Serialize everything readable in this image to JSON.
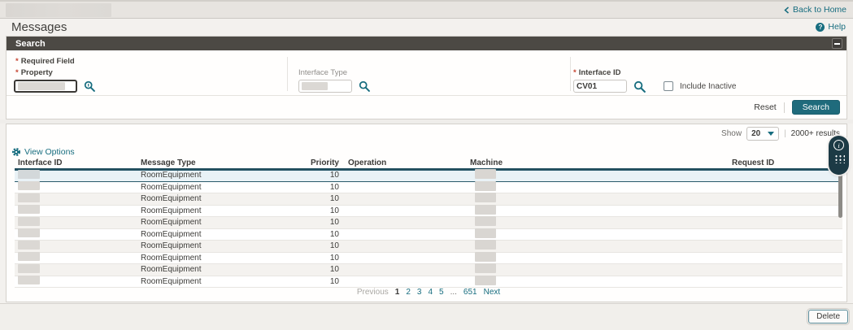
{
  "topbar": {
    "back_to_home": "Back to Home"
  },
  "page": {
    "title": "Messages",
    "help": "Help"
  },
  "search": {
    "panel_title": "Search",
    "required_note": "Required Field",
    "property_label": "Property",
    "interface_type_label": "Interface Type",
    "interface_id_label": "Interface ID",
    "interface_id_value": "CV01",
    "include_inactive_label": "Include Inactive",
    "include_inactive_checked": false,
    "reset": "Reset",
    "search": "Search"
  },
  "results": {
    "show_label": "Show",
    "page_size": "20",
    "count": "2000+ results",
    "view_options": "View Options",
    "columns": [
      "Interface ID",
      "Message Type",
      "Priority",
      "Operation",
      "Machine",
      "Request ID"
    ],
    "selected_row_index": 0,
    "rows": [
      {
        "message_type": "RoomEquipment",
        "priority": "10"
      },
      {
        "message_type": "RoomEquipment",
        "priority": "10"
      },
      {
        "message_type": "RoomEquipment",
        "priority": "10"
      },
      {
        "message_type": "RoomEquipment",
        "priority": "10"
      },
      {
        "message_type": "RoomEquipment",
        "priority": "10"
      },
      {
        "message_type": "RoomEquipment",
        "priority": "10"
      },
      {
        "message_type": "RoomEquipment",
        "priority": "10"
      },
      {
        "message_type": "RoomEquipment",
        "priority": "10"
      },
      {
        "message_type": "RoomEquipment",
        "priority": "10"
      },
      {
        "message_type": "RoomEquipment",
        "priority": "10"
      }
    ],
    "pagination": {
      "previous": "Previous",
      "pages": [
        "1",
        "2",
        "3",
        "4",
        "5"
      ],
      "current_page": "1",
      "ellipsis": "...",
      "last": "651",
      "next": "Next"
    }
  },
  "footer": {
    "delete": "Delete"
  },
  "colors": {
    "accent": "#176d7f",
    "panel_header_bg": "#4c4944",
    "primary_button_bg": "#1f6b7c",
    "required_marker": "#c74634",
    "selected_row_bg": "#e9f2f6",
    "selected_row_border": "#2a5a6b"
  }
}
